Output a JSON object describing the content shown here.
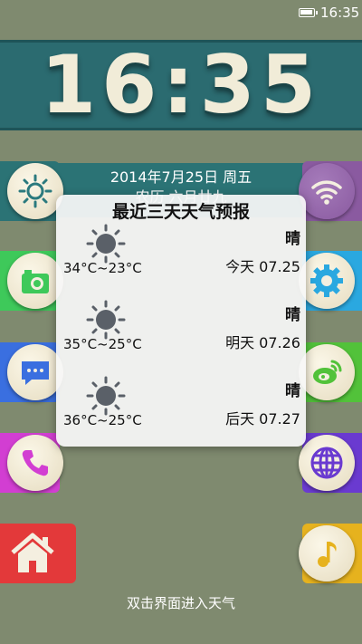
{
  "status_bar": {
    "time": "16:35"
  },
  "clock": {
    "time": "16:35"
  },
  "date": {
    "line1": "2014年7月25日 周五",
    "line2": "农历 六月廿九"
  },
  "weather_card": {
    "title": "最近三天天气预报",
    "days": [
      {
        "range": "34°C~23°C",
        "condition": "晴",
        "label": "今天 07.25"
      },
      {
        "range": "35°C~25°C",
        "condition": "晴",
        "label": "明天 07.26"
      },
      {
        "range": "36°C~25°C",
        "condition": "晴",
        "label": "后天 07.27"
      }
    ]
  },
  "tiles": {
    "left": [
      {
        "name": "weather-app",
        "icon": "sun-icon",
        "color": "#2b7375"
      },
      {
        "name": "camera-app",
        "icon": "camera-icon",
        "color": "#3ec95a"
      },
      {
        "name": "messages-app",
        "icon": "message-icon",
        "color": "#3a6fe0"
      },
      {
        "name": "phone-app",
        "icon": "phone-icon",
        "color": "#d23ed2"
      },
      {
        "name": "home-app",
        "icon": "home-icon",
        "color": "#e3393a"
      }
    ],
    "right": [
      {
        "name": "wifi-toggle",
        "icon": "wifi-icon",
        "color": "#8a5aa0"
      },
      {
        "name": "settings-app",
        "icon": "gear-icon",
        "color": "#2aa8e0"
      },
      {
        "name": "weibo-app",
        "icon": "weibo-icon",
        "color": "#52c23a"
      },
      {
        "name": "browser-app",
        "icon": "globe-icon",
        "color": "#6a3ad0"
      },
      {
        "name": "music-app",
        "icon": "music-note-icon",
        "color": "#e6b21e"
      }
    ]
  },
  "hint": "双击界面进入天气"
}
